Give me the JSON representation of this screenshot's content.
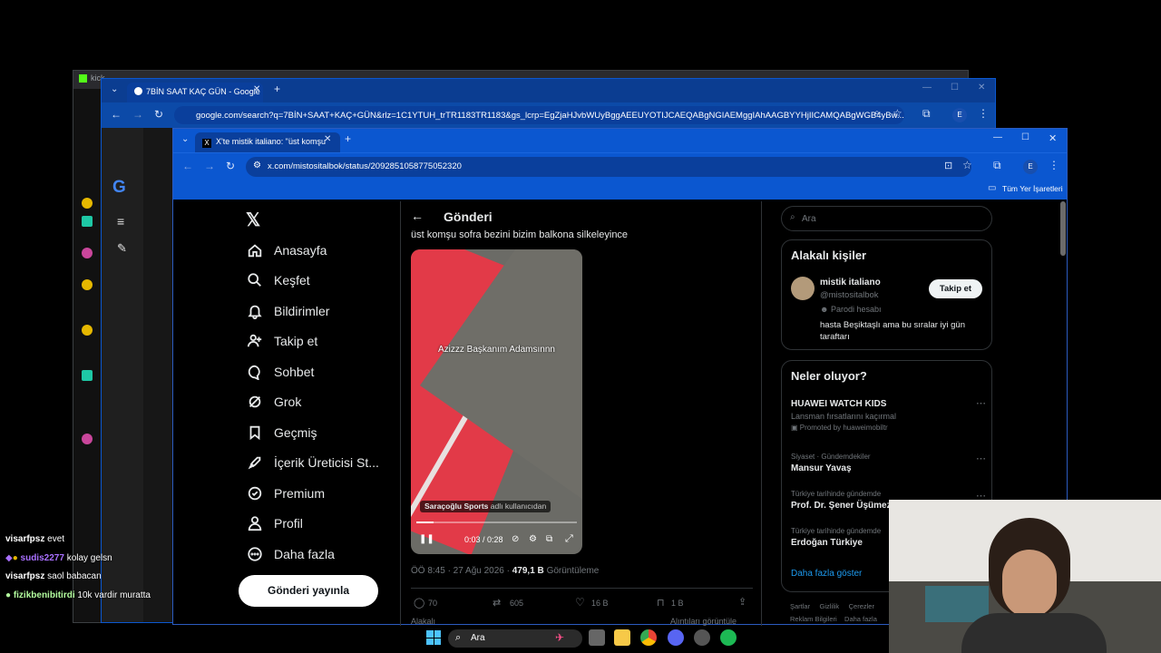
{
  "back_window": {
    "tab_text": "kick.",
    "tab2_text": "ki"
  },
  "google_window": {
    "tab_title": "7BİN SAAT KAÇ GÜN - Google",
    "url": "google.com/search?q=7BİN+SAAT+KAÇ+GÜN&rlz=1C1YTUH_trTR1183TR1183&gs_lcrp=EgZjaHJvbWUyBggAEEUYOTIJCAEQABgNGIAEMggIAhAAGBYYHjIICAMQABgWGB4yBw..."
  },
  "browser": {
    "tab_title": "X'te mistik italiano: \"üst komşu",
    "url": "x.com/mistositalbok/status/2092851058775052320",
    "bookmarks_label": "Tüm Yer İşaretleri",
    "profile_initial": "E"
  },
  "x_nav": {
    "items": [
      {
        "label": "Anasayfa",
        "icon": "home-icon"
      },
      {
        "label": "Keşfet",
        "icon": "search-icon"
      },
      {
        "label": "Bildirimler",
        "icon": "bell-icon"
      },
      {
        "label": "Takip et",
        "icon": "add-user-icon"
      },
      {
        "label": "Sohbet",
        "icon": "chat-icon"
      },
      {
        "label": "Grok",
        "icon": "grok-icon"
      },
      {
        "label": "Geçmiş",
        "icon": "bookmark-icon"
      },
      {
        "label": "İçerik Üreticisi St...",
        "icon": "rocket-icon"
      },
      {
        "label": "Premium",
        "icon": "verified-icon"
      },
      {
        "label": "Profil",
        "icon": "person-icon"
      },
      {
        "label": "Daha fazla",
        "icon": "more-circle-icon"
      }
    ],
    "post_button": "Gönderi yayınla"
  },
  "post": {
    "header": "Gönderi",
    "text": "üst komşu sofra bezini bizim balkona silkeleyince",
    "video_caption": "Azizzz Başkanım Adamsınnn",
    "attribution_name": "Saraçoğlu Sports",
    "attribution_suffix": "adlı kullanıcıdan",
    "time": "0:03 / 0:28",
    "progress": 0.107,
    "meta_date": "ÖÖ 8:45 · 27 Ağu 2026 ·",
    "views_count": "479,1 B",
    "views_label": "Görüntüleme",
    "replies": "70",
    "reposts": "605",
    "likes": "16 B",
    "bookmarks": "1 B",
    "footer_left": "Alakalı",
    "footer_right": "Alıntıları görüntüle"
  },
  "right_col": {
    "search_placeholder": "Ara",
    "related_title": "Alakalı kişiler",
    "person_name": "mistik italiano",
    "person_handle": "@mistositalbok",
    "person_badge": "Parodi hesabı",
    "person_bio": "hasta Beşiktaşlı ama bu sıralar iyi gün taraftarı",
    "follow_button": "Takip et",
    "trends_title": "Neler oluyor?",
    "trends": [
      {
        "meta": "",
        "title": "HUAWEI WATCH KIDS",
        "sub": "Lansman fırsatlarını kaçırmal",
        "promo": "Promoted by huaweimobiltr"
      },
      {
        "meta": "Siyaset · Gündemdekiler",
        "title": "Mansur Yavaş",
        "sub": "",
        "promo": ""
      },
      {
        "meta": "Türkiye tarihinde gündemde",
        "title": "Prof. Dr. Şener Üşümez",
        "sub": "",
        "promo": ""
      },
      {
        "meta": "Türkiye tarihinde gündemde",
        "title": "Erdoğan Türkiye",
        "sub": "",
        "promo": ""
      }
    ],
    "show_more": "Daha fazla göster",
    "footer_links": [
      "Şartlar",
      "Gizlilik",
      "Çerezler",
      "Reklam Bilgileri",
      "Daha fazla"
    ]
  },
  "chat": [
    {
      "user": "visarfpsz",
      "msg": "evet",
      "color": "#f2f2f2"
    },
    {
      "user": "sudis2277",
      "msg": "kolay gelsn",
      "color": "#a970ff"
    },
    {
      "user": "visarfpsz",
      "msg": "saol babacan",
      "color": "#f2f2f2"
    },
    {
      "user": "fizikbenibitirdi",
      "msg": "10k vardir muratta",
      "color": "#b4ff9f"
    }
  ],
  "taskbar": {
    "search_label": "Ara"
  }
}
